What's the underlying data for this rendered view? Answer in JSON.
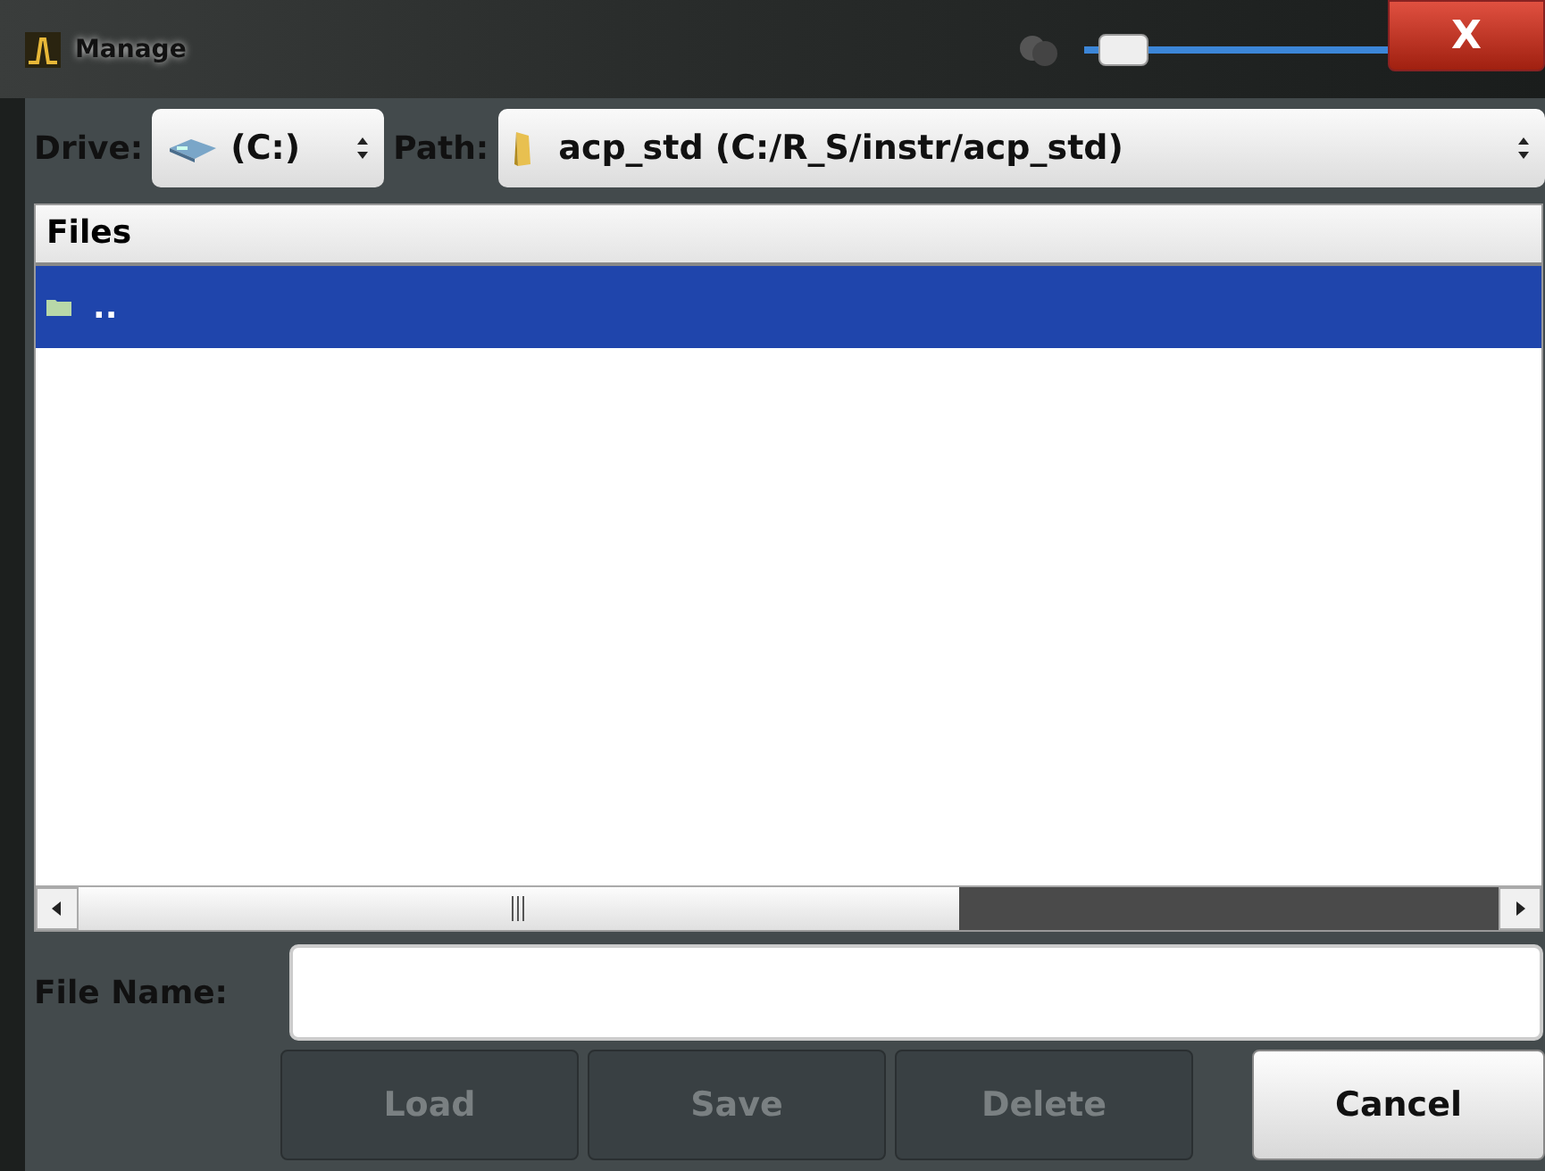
{
  "window": {
    "title": "Manage",
    "close_label": "X",
    "transparency": {
      "level": 0.05
    }
  },
  "drive": {
    "label": "Drive:",
    "value": "(C:)"
  },
  "path": {
    "label": "Path:",
    "value": "acp_std (C:/R_S/instr/acp_std)"
  },
  "files": {
    "header": "Files",
    "rows": [
      {
        "name": "..",
        "selected": true
      }
    ]
  },
  "file_name": {
    "label": "File Name:"
  },
  "buttons": [
    {
      "label": "Load",
      "disabled": true
    },
    {
      "label": "Save",
      "disabled": true
    },
    {
      "label": "Delete",
      "disabled": true
    },
    {
      "label": "Cancel",
      "disabled": false
    }
  ]
}
